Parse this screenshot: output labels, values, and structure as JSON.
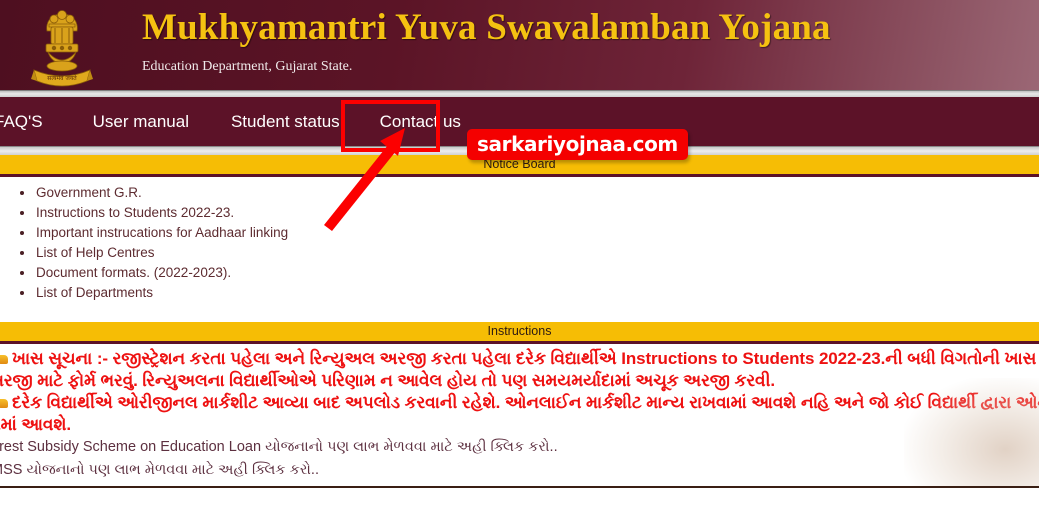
{
  "header": {
    "emblem_icon": "india-state-emblem-icon",
    "title": "Mukhyamantri Yuva Swavalamban Yojana",
    "subtitle": "Education Department, Gujarat State.",
    "brand_gold": "#f5c211",
    "brand_maroon": "#5c1228"
  },
  "navbar": {
    "items": [
      {
        "label": "FAQ'S",
        "name": "nav-item-faqs",
        "clipped": true
      },
      {
        "label": "User manual",
        "name": "nav-item-user-manual",
        "clipped": false
      },
      {
        "label": "Student status",
        "name": "nav-item-student-status",
        "clipped": false
      },
      {
        "label": "Contact us",
        "name": "nav-item-contact-us",
        "clipped": false
      }
    ]
  },
  "notice_board": {
    "header": "Notice Board",
    "items": [
      "Government G.R.",
      "Instructions to Students 2022-23.",
      "Important instrucations for Aadhaar linking",
      "List of Help Centres",
      "Document formats. (2022-2023).",
      "List of Departments"
    ]
  },
  "watermark": {
    "text": "sarkariyojnaa.com",
    "bg_color": "#f40000",
    "text_color": "#ffffff"
  },
  "instructions": {
    "header": "Instructions",
    "red_lines": [
      "ખાસ સૂચના :- રજીસ્ટ્રેશન કરતા પહેલા અને રિન્યુઅલ અરજી કરતા પહેલા દરેક વિદ્યાર્થીએ Instructions to Students 2022-23.ની બધી વિગતોની ખાસ સૂચનાઓ અન",
      "અરજી માટે ફોર્મ ભરવું. રિન્યુઅલના વિદ્યાર્થીઓએ પરિણામ ન આવેલ હોય તો પણ સમયમર્યાદામાં અચૂક અરજી કરવી.",
      "દરેક વિદ્યાર્થીએ ઓરીજીનલ માર્કશીટ આવ્યા બાદ અપલોડ કરવાની રહેશે. ઓનલાઈન માર્કશીટ માન્ય રાખવામાં આવશે નહિ અને જો કોઈ વિદ્યાર્થી દ્વારા ઓનલાઈન માર્કશીટ",
      "વામાં આવશે."
    ],
    "dark_lines": [
      "erest Subsidy Scheme on Education Loan યોજનાનો પણ લાભ મેળવવા માટે અહી ક્લિક કરો..",
      "MSS યોજનાનો પણ લાભ મેળવવા માટે અહી ક્લિક કરો.."
    ],
    "text_color_red": "#ee1111",
    "text_color_dark": "#5d3040"
  },
  "annotations": {
    "highlight_box": {
      "target": "Contact us",
      "color": "#fc0000"
    },
    "arrow": {
      "points_to": "Contact us",
      "color": "#fc0000"
    }
  }
}
